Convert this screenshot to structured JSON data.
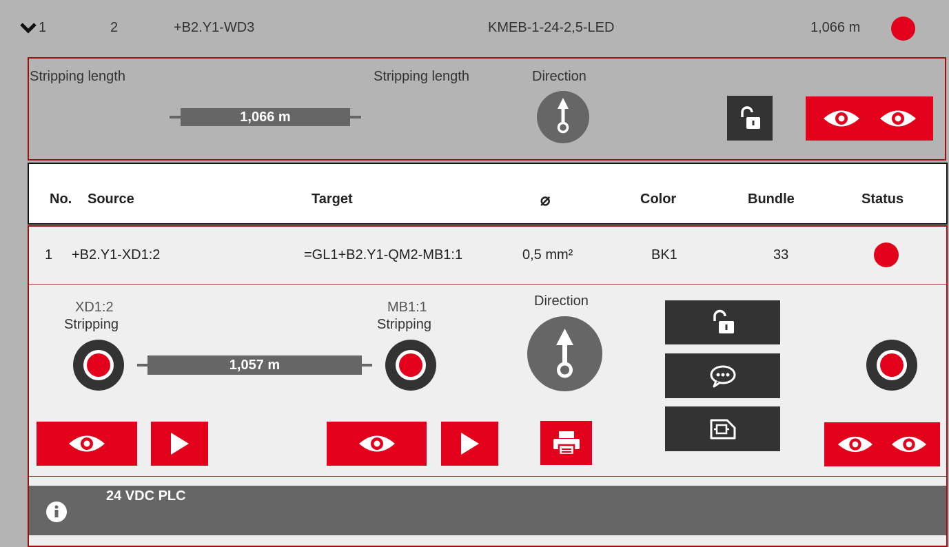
{
  "cable_row": {
    "index": "1",
    "number": "2",
    "id": "+B2.Y1-WD3",
    "type": "KMEB-1-24-2,5-LED",
    "length": "1,066 m",
    "status_color": "#e2001a"
  },
  "cable_detail": {
    "stripping_left_label": "Stripping length",
    "stripping_right_label": "Stripping length",
    "length_bar": "1,066 m",
    "direction_label": "Direction"
  },
  "table_header": {
    "no": "No.",
    "source": "Source",
    "target": "Target",
    "diameter": "⌀",
    "color": "Color",
    "bundle": "Bundle",
    "status": "Status"
  },
  "wire_row": {
    "no": "1",
    "source": "+B2.Y1-XD1:2",
    "target": "=GL1+B2.Y1-QM2-MB1:1",
    "diameter": "0,5 mm²",
    "color": "BK1",
    "bundle": "33"
  },
  "wire_detail": {
    "left_terminal": "XD1:2",
    "left_stripping": "Stripping",
    "right_terminal": "MB1:1",
    "right_stripping": "Stripping",
    "length_bar": "1,057 m",
    "direction_label": "Direction"
  },
  "info_bar": {
    "text": "24 VDC PLC"
  },
  "colors": {
    "accent": "#e2001a",
    "dark": "#333333",
    "bar": "#666666"
  }
}
